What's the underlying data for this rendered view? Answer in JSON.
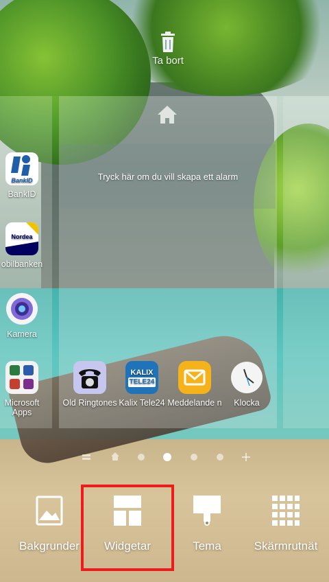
{
  "trash": {
    "label": "Ta bort"
  },
  "alarm_widget": {
    "text": "Tryck här om du vill skapa ett alarm"
  },
  "left_panel_apps": [
    {
      "label": "BankID"
    },
    {
      "label": "obilbanken"
    },
    {
      "label": "Kamera"
    },
    {
      "label": "Microsoft Apps"
    }
  ],
  "dock_apps": [
    {
      "label": "Old Ringtones"
    },
    {
      "label": "Kalix Tele24"
    },
    {
      "label": "Meddelande n"
    },
    {
      "label": "Klocka"
    }
  ],
  "icon_text": {
    "bankid": "BankID",
    "nordea": "Nordea",
    "kalix_top": "KALIX",
    "kalix_bottom": "TELE24"
  },
  "page_indicator": {
    "count": 7,
    "active_index": 3
  },
  "bottom_options": [
    {
      "label": "Bakgrunder",
      "icon": "wallpaper-icon"
    },
    {
      "label": "Widgetar",
      "icon": "widgets-icon",
      "highlighted": true
    },
    {
      "label": "Tema",
      "icon": "theme-icon"
    },
    {
      "label": "Skärmrutnät",
      "icon": "grid-icon"
    }
  ],
  "colors": {
    "highlight": "#ee1b1b"
  }
}
